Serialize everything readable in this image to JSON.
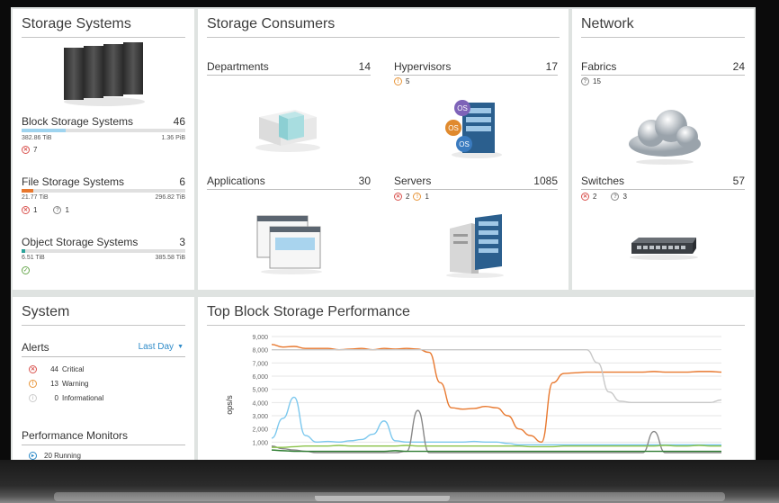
{
  "storage_systems": {
    "title": "Storage Systems",
    "icon": "server-rack-icon",
    "block": {
      "label": "Block Storage Systems",
      "count": "46",
      "used": "382.86 TiB",
      "total": "1.36 PiB",
      "fill_fraction": 0.27,
      "fill_color": "#9fd4ef",
      "errors": "7"
    },
    "file": {
      "label": "File Storage Systems",
      "count": "6",
      "used": "21.77 TiB",
      "total": "296.82 TiB",
      "fill_fraction": 0.07,
      "fill_color": "#e8782e",
      "errors": "1",
      "unknown": "1"
    },
    "object": {
      "label": "Object Storage Systems",
      "count": "3",
      "used": "6.51 TiB",
      "total": "385.58 TiB",
      "fill_fraction": 0.02,
      "fill_color": "#2aa39a"
    }
  },
  "storage_consumers": {
    "title": "Storage Consumers",
    "departments": {
      "label": "Departments",
      "count": "14"
    },
    "hypervisors": {
      "label": "Hypervisors",
      "count": "17",
      "warnings": "5"
    },
    "applications": {
      "label": "Applications",
      "count": "30"
    },
    "servers": {
      "label": "Servers",
      "count": "1085",
      "errors": "2",
      "warnings": "1"
    }
  },
  "network": {
    "title": "Network",
    "fabrics": {
      "label": "Fabrics",
      "count": "24",
      "unknown": "15"
    },
    "switches": {
      "label": "Switches",
      "count": "57",
      "errors": "2",
      "unknown": "3"
    }
  },
  "system": {
    "title": "System",
    "alerts_label": "Alerts",
    "period": "Last Day",
    "alerts": [
      {
        "count": "44",
        "label": "Critical",
        "type": "err"
      },
      {
        "count": "13",
        "label": "Warning",
        "type": "warn"
      },
      {
        "count": "0",
        "label": "Informational",
        "type": "info"
      }
    ],
    "perf_monitors_label": "Performance Monitors",
    "perf_running": "20 Running"
  },
  "performance": {
    "title": "Top Block Storage Performance"
  },
  "chart_data": {
    "type": "line",
    "title": "Top Block Storage Performance",
    "xlabel": "",
    "ylabel": "ops/s",
    "ylim": [
      0,
      9000
    ],
    "yticks": [
      "1,000",
      "2,000",
      "3,000",
      "4,000",
      "5,000",
      "6,000",
      "7,000",
      "8,000",
      "9,000"
    ],
    "ytick_values": [
      1000,
      2000,
      3000,
      4000,
      5000,
      6000,
      7000,
      8000,
      9000
    ],
    "x": [
      0,
      1,
      2,
      3,
      4,
      5,
      6,
      7,
      8,
      9,
      10,
      11,
      12,
      13,
      14,
      15,
      16,
      17,
      18,
      19,
      20,
      21,
      22,
      23,
      24,
      25,
      26,
      27,
      28,
      29,
      30,
      31,
      32,
      33,
      34,
      35,
      36,
      37,
      38,
      39,
      40
    ],
    "series": [
      {
        "name": "orange",
        "color": "#e8782e",
        "values": [
          8400,
          8200,
          8250,
          8100,
          8100,
          8100,
          8000,
          8050,
          8100,
          8000,
          8100,
          8050,
          8100,
          8050,
          7800,
          5500,
          3600,
          3500,
          3550,
          3700,
          3600,
          3000,
          2000,
          1500,
          1000,
          5500,
          6200,
          6250,
          6300,
          6300,
          6300,
          6300,
          6300,
          6300,
          6350,
          6300,
          6300,
          6300,
          6350,
          6350,
          6300
        ]
      },
      {
        "name": "light-gray",
        "color": "#c8c8c8",
        "values": [
          8000,
          8000,
          8000,
          8000,
          8000,
          8000,
          8000,
          8000,
          8000,
          8000,
          8000,
          8000,
          8000,
          8000,
          8000,
          8000,
          8000,
          8000,
          8000,
          8000,
          8000,
          8000,
          8000,
          8000,
          8000,
          8000,
          8000,
          8000,
          8000,
          7000,
          4800,
          4100,
          4000,
          4000,
          4000,
          4000,
          4000,
          4000,
          4000,
          4000,
          4200
        ]
      },
      {
        "name": "light-blue",
        "color": "#7cc8ee",
        "values": [
          1300,
          2800,
          4400,
          1500,
          1000,
          1050,
          1000,
          1100,
          1200,
          1600,
          2600,
          1100,
          1000,
          1000,
          1000,
          1000,
          1000,
          1000,
          1050,
          1000,
          1000,
          900,
          800,
          800,
          800,
          800,
          800,
          800,
          800,
          800,
          800,
          800,
          800,
          800,
          800,
          800,
          800,
          800,
          800,
          800,
          800
        ]
      },
      {
        "name": "dark-gray",
        "color": "#888888",
        "values": [
          700,
          500,
          400,
          300,
          200,
          200,
          200,
          200,
          200,
          200,
          200,
          200,
          300,
          3400,
          200,
          200,
          200,
          200,
          200,
          200,
          200,
          200,
          200,
          200,
          200,
          200,
          200,
          200,
          200,
          200,
          200,
          200,
          200,
          200,
          1800,
          200,
          200,
          200,
          200,
          200,
          200
        ]
      },
      {
        "name": "green",
        "color": "#8bc34a",
        "values": [
          600,
          600,
          650,
          700,
          700,
          700,
          750,
          700,
          700,
          700,
          700,
          700,
          750,
          700,
          700,
          700,
          700,
          700,
          700,
          700,
          700,
          700,
          700,
          650,
          650,
          650,
          700,
          700,
          700,
          700,
          700,
          700,
          700,
          700,
          700,
          750,
          700,
          700,
          750,
          700,
          700
        ]
      },
      {
        "name": "dark-green",
        "color": "#2e7d32",
        "values": [
          400,
          350,
          300,
          300,
          300,
          300,
          300,
          300,
          300,
          300,
          300,
          350,
          300,
          300,
          300,
          300,
          300,
          300,
          300,
          300,
          300,
          300,
          300,
          300,
          300,
          300,
          300,
          300,
          300,
          300,
          300,
          300,
          300,
          300,
          300,
          300,
          300,
          300,
          300,
          300,
          300
        ]
      }
    ],
    "grid": true,
    "legend": "none"
  }
}
